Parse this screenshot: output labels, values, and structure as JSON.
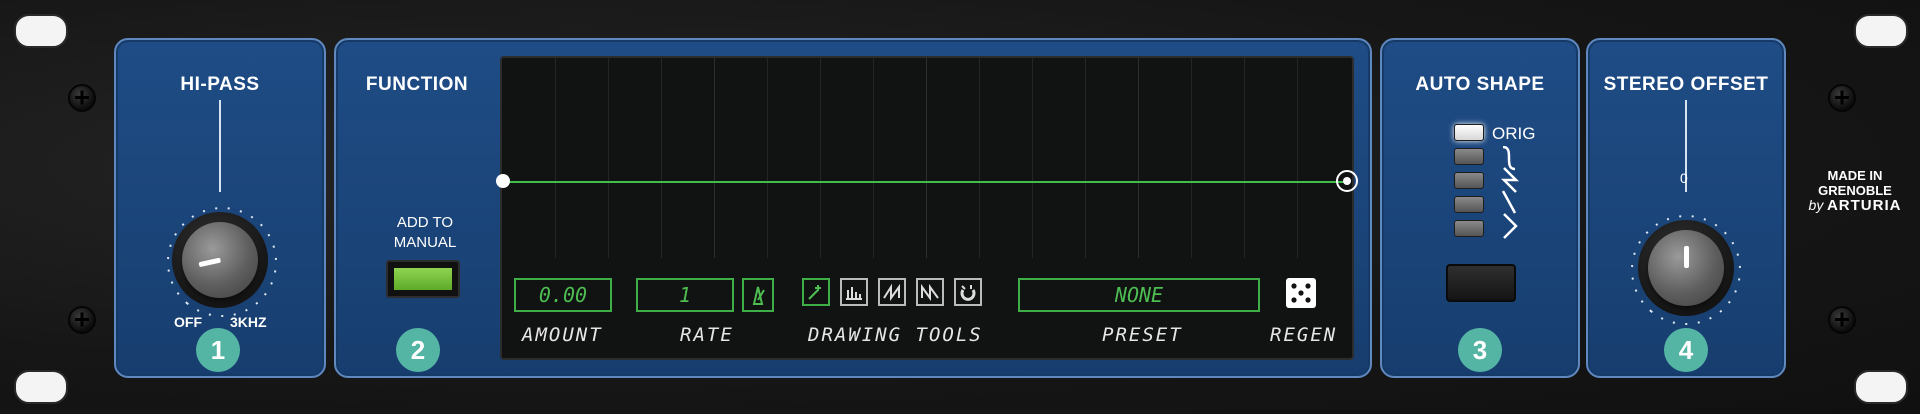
{
  "hipass": {
    "title": "HI-PASS",
    "min_label": "OFF",
    "max_label": "3KHZ",
    "badge": "1",
    "value_fraction": 0.12
  },
  "function": {
    "title": "FUNCTION",
    "add_to_manual_line1": "ADD TO",
    "add_to_manual_line2": "MANUAL",
    "badge": "2",
    "display": {
      "amount_value": "0.00",
      "amount_label": "AMOUNT",
      "rate_value": "1",
      "rate_label": "RATE",
      "drawing_tools_label": "DRAWING TOOLS",
      "preset_value": "NONE",
      "preset_label": "PRESET",
      "regen_label": "REGEN"
    },
    "accent_green": "#3fae46"
  },
  "auto_shape": {
    "title": "AUTO SHAPE",
    "orig_label": "ORIG",
    "badge": "3",
    "options_active_index": 0
  },
  "stereo_offset": {
    "title": "STEREO OFFSET",
    "value": "0",
    "badge": "4",
    "value_fraction": 0.5
  },
  "brand": {
    "line1": "MADE IN",
    "line2": "GRENOBLE",
    "by": "by",
    "name": "ARTURIA"
  },
  "colors": {
    "panel_blue": "#1f4c86",
    "badge_teal": "#54b5a5"
  }
}
